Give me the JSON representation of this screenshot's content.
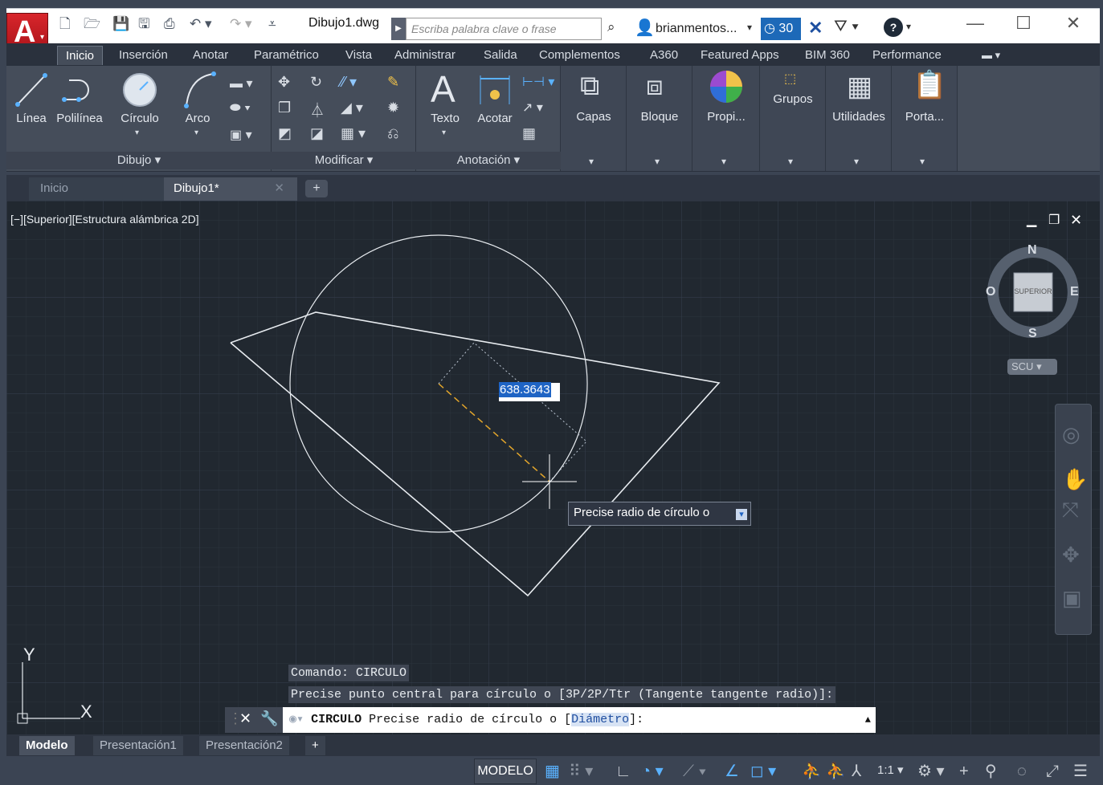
{
  "app": {
    "document_title": "Dibujo1.dwg",
    "search_placeholder": "Escriba palabra clave o frase",
    "user_name": "brianmentos...",
    "a360_count": "30"
  },
  "ribbon_tabs": [
    "Inicio",
    "Inserción",
    "Anotar",
    "Paramétrico",
    "Vista",
    "Administrar",
    "Salida",
    "Complementos",
    "A360",
    "Featured Apps",
    "BIM 360",
    "Performance"
  ],
  "ribbon": {
    "draw": {
      "linea": "Línea",
      "polilinea": "Polilínea",
      "circulo": "Círculo",
      "arco": "Arco",
      "panel_title": "Dibujo ▾"
    },
    "modify": {
      "panel_title": "Modificar ▾"
    },
    "annotation": {
      "texto": "Texto",
      "acotar": "Acotar",
      "panel_title": "Anotación ▾"
    },
    "capas": "Capas",
    "bloque": "Bloque",
    "propi": "Propi...",
    "grupos": "Grupos",
    "utilidades": "Utilidades",
    "porta": "Porta..."
  },
  "doc_tabs": {
    "home": "Inicio",
    "current": "Dibujo1*"
  },
  "viewport": {
    "label": "[−][Superior][Estructura alámbrica 2D]",
    "viewcube": {
      "n": "N",
      "s": "S",
      "e": "E",
      "o": "O",
      "face": "SUPERIOR",
      "ucs": "SCU"
    },
    "ucs_x": "X",
    "ucs_y": "Y"
  },
  "dynamic_input": {
    "value": "638.3643",
    "tooltip": "Precise radio de círculo o"
  },
  "command": {
    "history_1": "Comando: CIRCULO",
    "history_2": "Precise punto central para círculo o [3P/2P/Ttr (Tangente tangente radio)]:",
    "prompt_cmd": "CIRCULO",
    "prompt_text": "Precise radio de círculo o [",
    "prompt_option": "Diámetro",
    "prompt_end": "]:"
  },
  "layout_tabs": [
    "Modelo",
    "Presentación1",
    "Presentación2"
  ],
  "status": {
    "modelo": "MODELO",
    "scale": "1:1"
  },
  "colors": {
    "canvas": "#212830",
    "ribbon": "#454d5a",
    "accent": "#1f64c4",
    "status_icon": "#5ab2ff"
  }
}
